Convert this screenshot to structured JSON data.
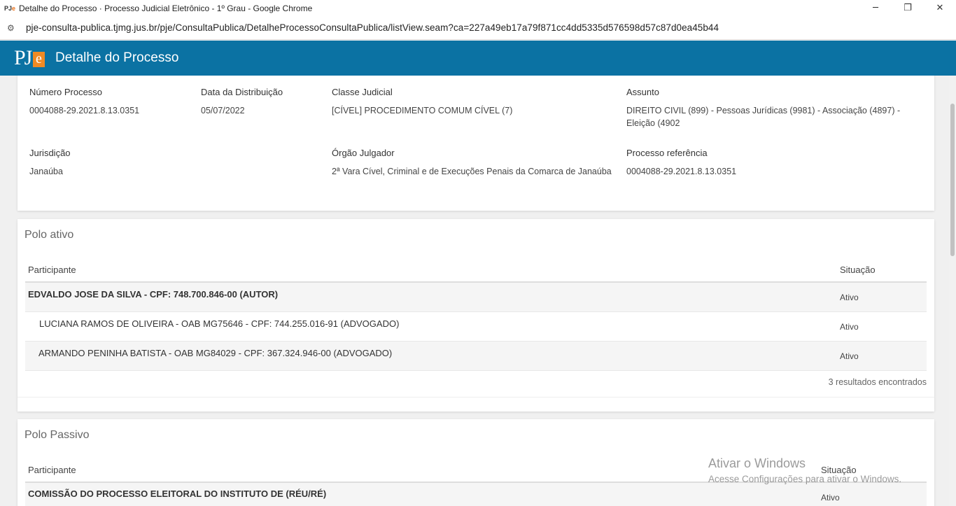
{
  "browser": {
    "title": "Detalhe do Processo · Processo Judicial Eletrônico - 1º Grau - Google Chrome",
    "url": "pje-consulta-publica.tjmg.jus.br/pje/ConsultaPublica/DetalheProcessoConsultaPublica/listView.seam?ca=227a49eb17a79f871cc4dd5335d576598d57c87d0ea45b44",
    "minimize": "─",
    "restore": "❐",
    "close": "✕"
  },
  "app": {
    "logo_pj": "PJ",
    "logo_e": "e",
    "title": "Detalhe do Processo"
  },
  "processo": {
    "numero_label": "Número Processo",
    "numero": "0004088-29.2021.8.13.0351",
    "data_label": "Data da Distribuição",
    "data": "05/07/2022",
    "classe_label": "Classe Judicial",
    "classe": "[CÍVEL] PROCEDIMENTO COMUM CÍVEL (7)",
    "assunto_label": "Assunto",
    "assunto_line1": "DIREITO CIVIL (899) - Pessoas Jurídicas (9981) - Associação (4897) -",
    "assunto_line2": "Eleição (4902",
    "jurisdicao_label": "Jurisdição",
    "jurisdicao": "Janaúba",
    "orgao_label": "Órgão Julgador",
    "orgao": "2ª Vara Cível, Criminal e de Execuções Penais da Comarca de Janaúba",
    "referencia_label": "Processo referência",
    "referencia": "0004088-29.2021.8.13.0351"
  },
  "polo_ativo": {
    "title": "Polo ativo",
    "col_participante": "Participante",
    "col_situacao": "Situação",
    "rows": [
      {
        "participante": "EDVALDO JOSE DA SILVA - CPF: 748.700.846-00 (AUTOR)",
        "situacao": "Ativo"
      },
      {
        "participante": "LUCIANA RAMOS DE OLIVEIRA - OAB MG75646 - CPF: 744.255.016-91 (ADVOGADO)",
        "situacao": "Ativo"
      },
      {
        "participante": "ARMANDO PENINHA BATISTA - OAB MG84029 - CPF: 367.324.946-00 (ADVOGADO)",
        "situacao": "Ativo"
      }
    ],
    "results": "3 resultados encontrados"
  },
  "polo_passivo": {
    "title": "Polo Passivo",
    "col_participante": "Participante",
    "col_situacao": "Situação",
    "rows": [
      {
        "participante": "COMISSÃO DO PROCESSO ELEITORAL DO INSTITUTO DE (RÉU/RÉ)",
        "situacao": "Ativo"
      }
    ]
  },
  "watermark": {
    "line1": "Ativar o Windows",
    "line2": "Acesse Configurações para ativar o Windows."
  }
}
